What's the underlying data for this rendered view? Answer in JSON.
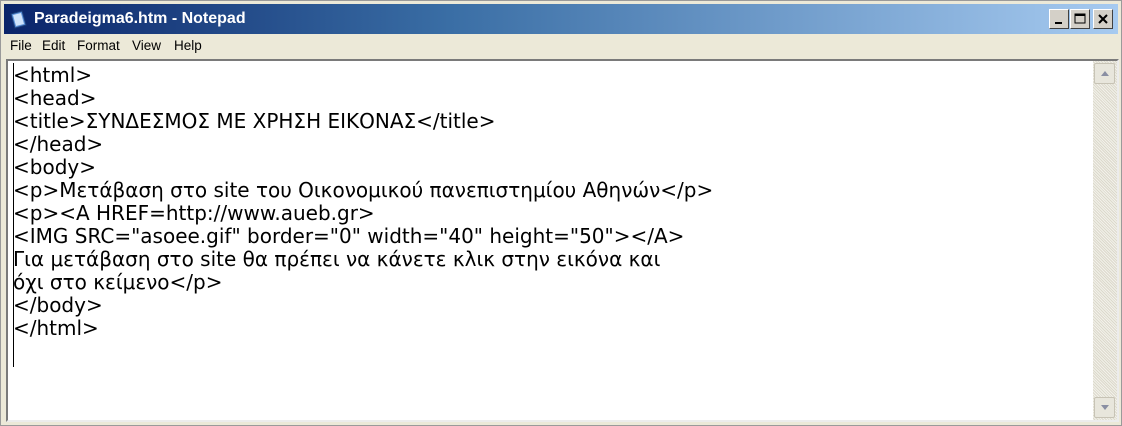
{
  "window": {
    "title": "Paradeigma6.htm - Notepad",
    "icons": {
      "app": "notepad-icon",
      "minimize": "minimize-icon",
      "maximize": "maximize-icon",
      "close": "close-icon"
    },
    "colors": {
      "titlebar_start": "#0a246a",
      "titlebar_end": "#a6caf0",
      "face": "#ece9d8"
    }
  },
  "menu": {
    "items": [
      {
        "label": "File"
      },
      {
        "label": "Edit"
      },
      {
        "label": "Format"
      },
      {
        "label": "View"
      },
      {
        "label": "Help"
      }
    ]
  },
  "editor": {
    "lines": [
      "<html>",
      "<head>",
      "<title>ΣΥΝΔΕΣΜΟΣ ΜΕ ΧΡΗΣΗ ΕΙΚΟΝΑΣ</title>",
      "</head>",
      "<body>",
      "<p>Μετάβαση στο site του Οικονομικού πανεπιστημίου Αθηνών</p>",
      "<p><A HREF=http://www.aueb.gr>",
      "<IMG SRC=\"asoee.gif\" border=\"0\" width=\"40\" height=\"50\"></A>",
      "Για μετάβαση στο site θα πρέπει να κάνετε κλικ στην εικόνα και",
      "όχι στο κείμενο</p>",
      "</body>",
      "</html>"
    ],
    "scrollbar_icons": {
      "up": "scroll-up-arrow-icon",
      "down": "scroll-down-arrow-icon"
    }
  }
}
